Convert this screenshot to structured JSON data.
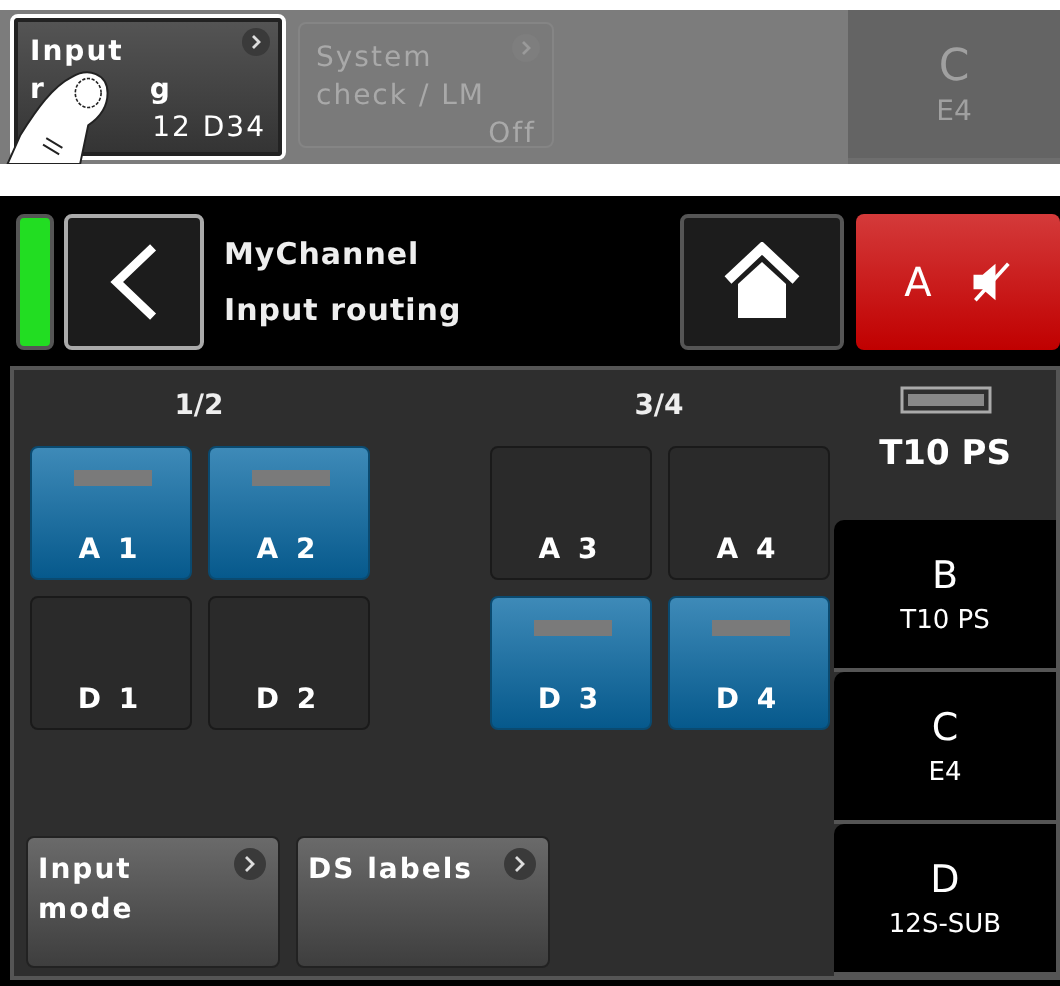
{
  "preview": {
    "buttons": [
      {
        "label_lines": [
          "Input",
          "r",
          "g"
        ],
        "value": "12 D34",
        "selected": true,
        "disabled": false
      },
      {
        "label_lines": [
          "System",
          "check / LM"
        ],
        "value": "Off",
        "selected": false,
        "disabled": true
      }
    ],
    "channel": {
      "letter": "C",
      "speaker": "E4"
    }
  },
  "header": {
    "status_on": true,
    "title": "MyChannel",
    "subtitle": "Input routing",
    "mute": {
      "channel": "A",
      "muted": true
    }
  },
  "groups": [
    {
      "label": "1/2",
      "inputs": [
        {
          "label": "A 1",
          "selected": true
        },
        {
          "label": "A 2",
          "selected": true
        },
        {
          "label": "D 1",
          "selected": false
        },
        {
          "label": "D 2",
          "selected": false
        }
      ]
    },
    {
      "label": "3/4",
      "inputs": [
        {
          "label": "A 3",
          "selected": false
        },
        {
          "label": "A 4",
          "selected": false
        },
        {
          "label": "D 3",
          "selected": true
        },
        {
          "label": "D 4",
          "selected": true
        }
      ]
    }
  ],
  "buttons": [
    "Input mode",
    "DS labels"
  ],
  "side": {
    "current": "T10 PS",
    "channels": [
      {
        "letter": "B",
        "speaker": "T10 PS"
      },
      {
        "letter": "C",
        "speaker": "E4"
      },
      {
        "letter": "D",
        "speaker": "12S-SUB"
      }
    ]
  }
}
